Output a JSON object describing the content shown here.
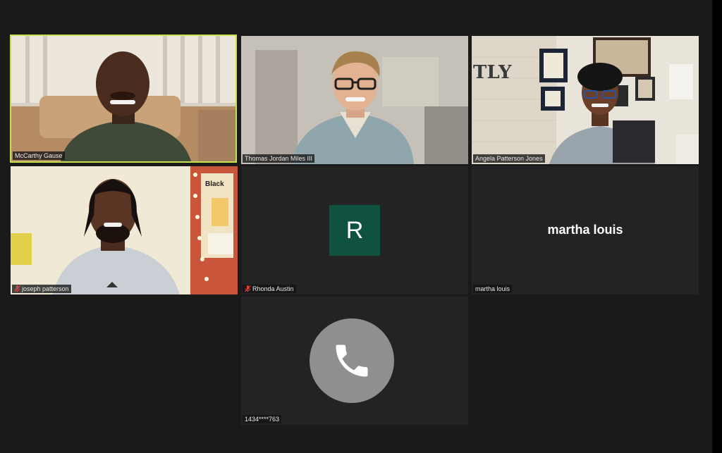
{
  "participants": [
    {
      "name": "McCarthy Gause",
      "muted": false,
      "active_speaker": true
    },
    {
      "name": "Thomas Jordan Miles III",
      "muted": false
    },
    {
      "name": "Angela Patterson Jones",
      "muted": false
    },
    {
      "name": "joseph patterson",
      "muted": true
    },
    {
      "name": "Rhonda Austin",
      "muted": true,
      "avatar_initial": "R",
      "avatar_color": "#0f5240"
    },
    {
      "name": "martha louis",
      "muted": false,
      "center_name": "martha louis"
    },
    {
      "name": "1434****763",
      "muted": false,
      "phone_icon": "phone-icon"
    }
  ],
  "colors": {
    "active_border": "#c6e24f",
    "background": "#1a1a1a",
    "tile": "#232323",
    "muted_icon": "#e0433e"
  }
}
